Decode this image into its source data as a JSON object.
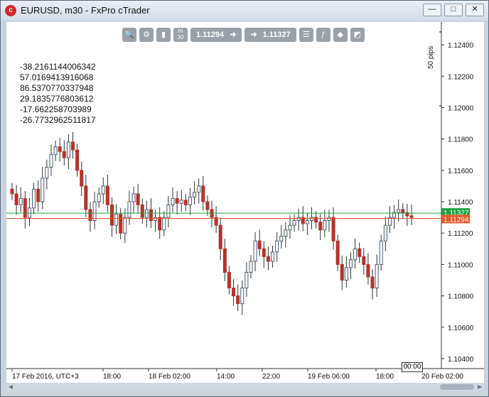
{
  "window": {
    "title": "EURUSD, m30 - FxPro cTrader",
    "app_icon": "cTrader",
    "buttons": [
      "minimize-icon",
      "maximize-icon",
      "close-icon"
    ]
  },
  "toolbar": {
    "icons": [
      "zoom-icon",
      "settings-icon",
      "chart-type-icon",
      "timeframe-icon",
      "trade-panel-icon",
      "indicators-icon",
      "cbot-icon",
      "drawing-icon"
    ],
    "timeframe": "m\n30",
    "bid_price": "1.11294",
    "ask_price": "1.11327"
  },
  "info_lines": [
    "-38.2161144006342",
    "57.0169413916068",
    "86.5370770337948",
    "29.1835776803612",
    "-17.662258703989",
    "-26.7732962511817"
  ],
  "pip_scale_label": "50 pips",
  "price_axis": [
    "1.12400",
    "1.12200",
    "1.12000",
    "1.11800",
    "1.11600",
    "1.11400",
    "1.11200",
    "1.11000",
    "1.10800",
    "1.10600",
    "1.10400"
  ],
  "time_axis": [
    "17 Feb 2016, UTC+3",
    "18:00",
    "18 Feb 02:00",
    "14:00",
    "22:00",
    "19 Feb 06:00",
    "18:00",
    "20 Feb 02:00"
  ],
  "time_cursor": "00:00",
  "ask_label": "1.11327",
  "bid_label": "1.11294",
  "colors": {
    "up_candle": "#4a5a70",
    "down_candle": "#b5332a",
    "ask_line": "#20a040",
    "bid_line": "#e05a2b"
  },
  "chart_data": {
    "type": "candlestick",
    "symbol": "EURUSD",
    "timeframe": "m30",
    "ylim": [
      1.1035,
      1.125
    ],
    "close_series": [
      1.1145,
      1.1138,
      1.1142,
      1.113,
      1.1136,
      1.1148,
      1.114,
      1.1155,
      1.1162,
      1.117,
      1.1175,
      1.1172,
      1.1168,
      1.1178,
      1.1173,
      1.116,
      1.115,
      1.1135,
      1.1128,
      1.114,
      1.1145,
      1.115,
      1.1138,
      1.1125,
      1.1132,
      1.112,
      1.113,
      1.114,
      1.1145,
      1.1138,
      1.113,
      1.1135,
      1.1128,
      1.113,
      1.1122,
      1.113,
      1.1138,
      1.1142,
      1.1139,
      1.1141,
      1.1138,
      1.1143,
      1.1146,
      1.115,
      1.114,
      1.1135,
      1.113,
      1.1125,
      1.111,
      1.1095,
      1.1085,
      1.108,
      1.1075,
      1.1085,
      1.1095,
      1.1102,
      1.1115,
      1.111,
      1.1105,
      1.1102,
      1.1108,
      1.1115,
      1.1118,
      1.1122,
      1.1125,
      1.1128,
      1.113,
      1.1126,
      1.1128,
      1.113,
      1.1127,
      1.1122,
      1.1128,
      1.113,
      1.1115,
      1.11,
      1.109,
      1.1098,
      1.1103,
      1.111,
      1.1105,
      1.11,
      1.1092,
      1.1085,
      1.11,
      1.1115,
      1.1125,
      1.113,
      1.1133,
      1.1135,
      1.1133,
      1.1131,
      1.113
    ]
  }
}
